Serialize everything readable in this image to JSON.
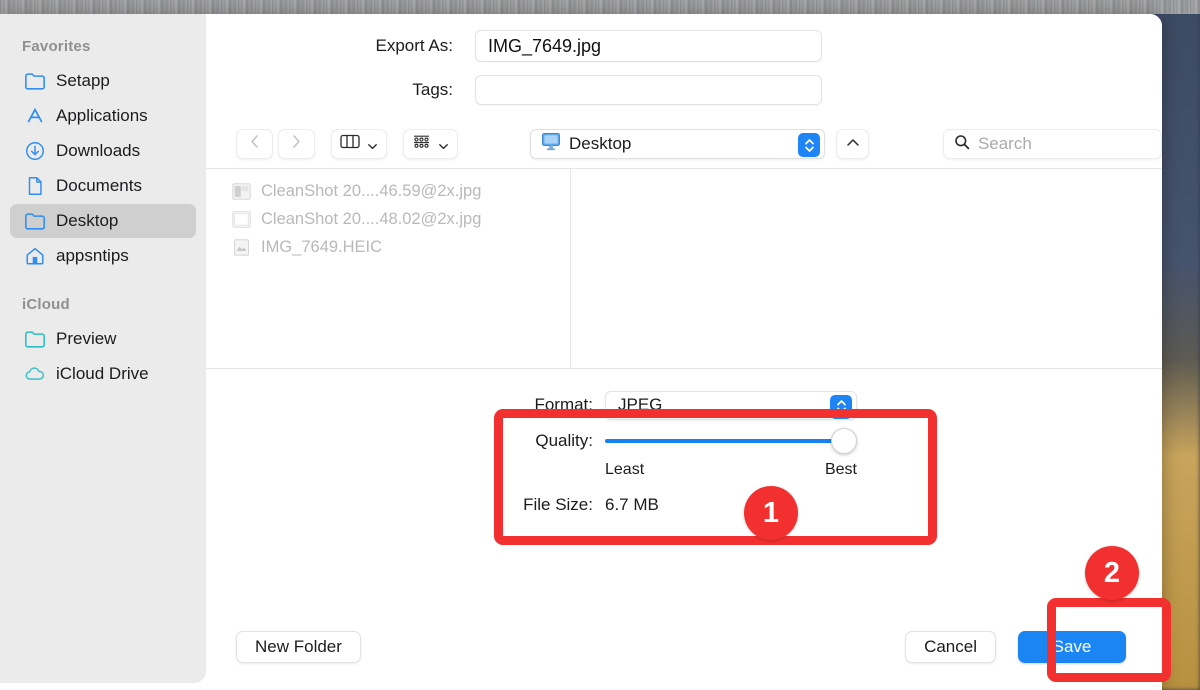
{
  "sidebar": {
    "sections": [
      {
        "title": "Favorites",
        "items": [
          {
            "label": "Setapp",
            "icon": "folder-icon",
            "selected": false
          },
          {
            "label": "Applications",
            "icon": "appstore-icon",
            "selected": false
          },
          {
            "label": "Downloads",
            "icon": "download-icon",
            "selected": false
          },
          {
            "label": "Documents",
            "icon": "document-icon",
            "selected": false
          },
          {
            "label": "Desktop",
            "icon": "folder-icon",
            "selected": true
          },
          {
            "label": "appsntips",
            "icon": "home-icon",
            "selected": false
          }
        ]
      },
      {
        "title": "iCloud",
        "items": [
          {
            "label": "Preview",
            "icon": "folder-icon",
            "selected": false
          },
          {
            "label": "iCloud Drive",
            "icon": "cloud-icon",
            "selected": false
          }
        ]
      }
    ]
  },
  "form": {
    "export_as_label": "Export As:",
    "export_as_value": "IMG_7649.jpg",
    "tags_label": "Tags:",
    "tags_value": "",
    "tags_placeholder": ""
  },
  "toolbar": {
    "back_icon": "chevron-left-icon",
    "forward_icon": "chevron-right-icon",
    "view_icon": "column-view-icon",
    "arrange_icon": "group-items-icon",
    "path_label": "Desktop",
    "path_icon": "display-icon",
    "stepper_icon": "updown-stepper-icon",
    "up_icon": "chevron-up-icon",
    "search_icon": "search-icon",
    "search_placeholder": "Search"
  },
  "browser": {
    "files": [
      {
        "name": "CleanShot 20....46.59@2x.jpg",
        "icon": "image-thumbnail-icon"
      },
      {
        "name": "CleanShot 20....48.02@2x.jpg",
        "icon": "image-thumbnail-icon"
      },
      {
        "name": "IMG_7649.HEIC",
        "icon": "image-thumbnail-icon"
      }
    ]
  },
  "options": {
    "format_label": "Format:",
    "format_value": "JPEG",
    "format_options": [
      "JPEG"
    ],
    "quality_label": "Quality:",
    "quality_least": "Least",
    "quality_best": "Best",
    "quality_percent": 100,
    "filesize_label": "File Size:",
    "filesize_value": "6.7 MB"
  },
  "actions": {
    "new_folder": "New Folder",
    "cancel": "Cancel",
    "save": "Save"
  },
  "annotations": {
    "badge_one": "1",
    "badge_two": "2",
    "highlight_color": "#f23030"
  }
}
